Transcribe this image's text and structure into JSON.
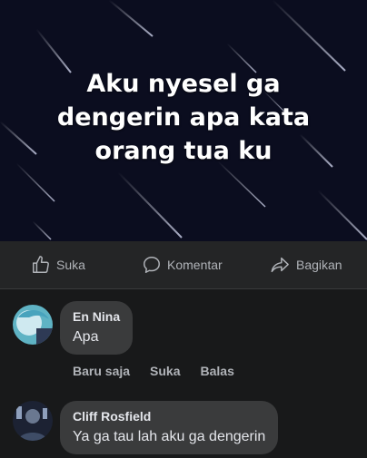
{
  "post": {
    "text_lines": [
      "Aku nyesel ga",
      "dengerin apa kata",
      "orang tua ku"
    ]
  },
  "actions": {
    "like_label": "Suka",
    "comment_label": "Komentar",
    "share_label": "Bagikan"
  },
  "comments": [
    {
      "author": "En Nina",
      "text": "Apa",
      "time": "Baru saja",
      "like_label": "Suka",
      "reply_label": "Balas"
    },
    {
      "author": "Cliff Rosfield",
      "text": "Ya ga tau lah aku ga dengerin"
    }
  ],
  "colors": {
    "background": "#18191a",
    "bubble": "#3a3b3c",
    "muted_text": "#b0b3b8",
    "post_background": "#0b0d1f"
  }
}
